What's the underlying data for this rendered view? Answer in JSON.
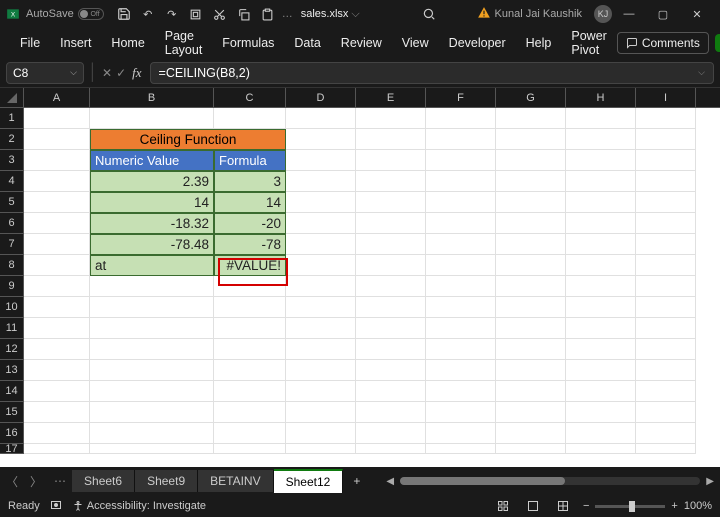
{
  "titlebar": {
    "autosave_label": "AutoSave",
    "autosave_state": "Off",
    "filename": "sales.xlsx",
    "dropdown_glyph": "⌵",
    "user_name": "Kunal Jai Kaushik",
    "user_initials": "KJ"
  },
  "quick_access": {
    "save": "💾",
    "undo": "↶",
    "redo": "↷",
    "touch": "⧉",
    "cut": "✂",
    "copy": "⧉",
    "paste": "📋",
    "more": "…"
  },
  "ribbon": {
    "tabs": [
      "File",
      "Insert",
      "Home",
      "Page Layout",
      "Formulas",
      "Data",
      "Review",
      "View",
      "Developer",
      "Help",
      "Power Pivot"
    ],
    "comments": "Comments",
    "share_glyph": "↗"
  },
  "fx": {
    "cell_ref": "C8",
    "fx_label": "fx",
    "formula": "=CEILING(B8,2)",
    "cancel": "✕",
    "enter": "✓"
  },
  "columns": [
    "A",
    "B",
    "C",
    "D",
    "E",
    "F",
    "G",
    "H",
    "I"
  ],
  "row_count": 17,
  "table": {
    "title": "Ceiling Function",
    "headers": {
      "numeric": "Numeric Value",
      "formula": "Formula"
    },
    "rows": [
      {
        "numeric": "2.39",
        "result": "3"
      },
      {
        "numeric": "14",
        "result": "14"
      },
      {
        "numeric": "-18.32",
        "result": "-20"
      },
      {
        "numeric": "-78.48",
        "result": "-78"
      },
      {
        "numeric": "at",
        "result": "#VALUE!"
      }
    ]
  },
  "sheets": {
    "tabs": [
      "Sheet6",
      "Sheet9",
      "BETAINV",
      "Sheet12"
    ],
    "active": "Sheet12",
    "ellipsis": "⋯",
    "add": "+"
  },
  "status": {
    "ready": "Ready",
    "accessibility": "Accessibility: Investigate",
    "zoom": "100%",
    "minus": "−",
    "plus": "+"
  },
  "chart_data": {
    "type": "table",
    "title": "Ceiling Function",
    "columns": [
      "Numeric Value",
      "Formula"
    ],
    "rows": [
      [
        "2.39",
        "3"
      ],
      [
        "14",
        "14"
      ],
      [
        "-18.32",
        "-20"
      ],
      [
        "-78.48",
        "-78"
      ],
      [
        "at",
        "#VALUE!"
      ]
    ]
  }
}
